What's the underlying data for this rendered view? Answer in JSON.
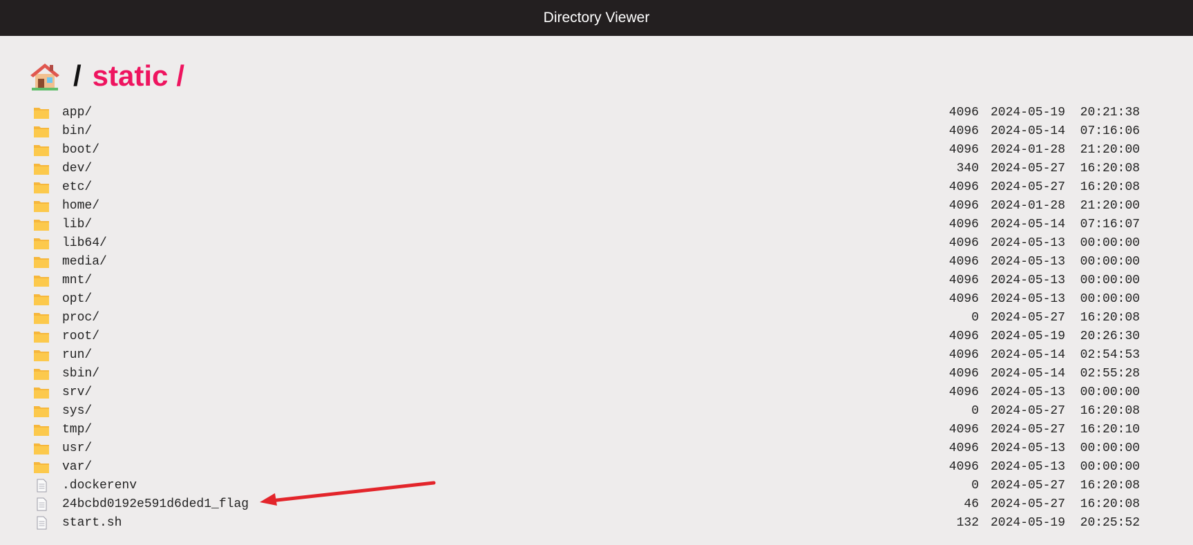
{
  "window": {
    "title": "Directory Viewer"
  },
  "breadcrumb": {
    "home_icon": "house-icon",
    "separator": "/",
    "current_dir": "static",
    "trailing_separator": "/"
  },
  "colors": {
    "topbar": "#231f20",
    "background": "#eeecec",
    "accent": "#ee145f",
    "folder": "#f6b73c",
    "annotation_arrow": "#e3252b"
  },
  "entries": [
    {
      "type": "folder",
      "icon": "folder-icon",
      "name": "app/",
      "size": "4096",
      "date": "2024-05-19",
      "time": "20:21:38"
    },
    {
      "type": "folder",
      "icon": "folder-icon",
      "name": "bin/",
      "size": "4096",
      "date": "2024-05-14",
      "time": "07:16:06"
    },
    {
      "type": "folder",
      "icon": "folder-icon",
      "name": "boot/",
      "size": "4096",
      "date": "2024-01-28",
      "time": "21:20:00"
    },
    {
      "type": "folder",
      "icon": "folder-icon",
      "name": "dev/",
      "size": "340",
      "date": "2024-05-27",
      "time": "16:20:08"
    },
    {
      "type": "folder",
      "icon": "folder-icon",
      "name": "etc/",
      "size": "4096",
      "date": "2024-05-27",
      "time": "16:20:08"
    },
    {
      "type": "folder",
      "icon": "folder-icon",
      "name": "home/",
      "size": "4096",
      "date": "2024-01-28",
      "time": "21:20:00"
    },
    {
      "type": "folder",
      "icon": "folder-icon",
      "name": "lib/",
      "size": "4096",
      "date": "2024-05-14",
      "time": "07:16:07"
    },
    {
      "type": "folder",
      "icon": "folder-icon",
      "name": "lib64/",
      "size": "4096",
      "date": "2024-05-13",
      "time": "00:00:00"
    },
    {
      "type": "folder",
      "icon": "folder-icon",
      "name": "media/",
      "size": "4096",
      "date": "2024-05-13",
      "time": "00:00:00"
    },
    {
      "type": "folder",
      "icon": "folder-icon",
      "name": "mnt/",
      "size": "4096",
      "date": "2024-05-13",
      "time": "00:00:00"
    },
    {
      "type": "folder",
      "icon": "folder-icon",
      "name": "opt/",
      "size": "4096",
      "date": "2024-05-13",
      "time": "00:00:00"
    },
    {
      "type": "folder",
      "icon": "folder-icon",
      "name": "proc/",
      "size": "0",
      "date": "2024-05-27",
      "time": "16:20:08"
    },
    {
      "type": "folder",
      "icon": "folder-icon",
      "name": "root/",
      "size": "4096",
      "date": "2024-05-19",
      "time": "20:26:30"
    },
    {
      "type": "folder",
      "icon": "folder-icon",
      "name": "run/",
      "size": "4096",
      "date": "2024-05-14",
      "time": "02:54:53"
    },
    {
      "type": "folder",
      "icon": "folder-icon",
      "name": "sbin/",
      "size": "4096",
      "date": "2024-05-14",
      "time": "02:55:28"
    },
    {
      "type": "folder",
      "icon": "folder-icon",
      "name": "srv/",
      "size": "4096",
      "date": "2024-05-13",
      "time": "00:00:00"
    },
    {
      "type": "folder",
      "icon": "folder-icon",
      "name": "sys/",
      "size": "0",
      "date": "2024-05-27",
      "time": "16:20:08"
    },
    {
      "type": "folder",
      "icon": "folder-icon",
      "name": "tmp/",
      "size": "4096",
      "date": "2024-05-27",
      "time": "16:20:10"
    },
    {
      "type": "folder",
      "icon": "folder-icon",
      "name": "usr/",
      "size": "4096",
      "date": "2024-05-13",
      "time": "00:00:00"
    },
    {
      "type": "folder",
      "icon": "folder-icon",
      "name": "var/",
      "size": "4096",
      "date": "2024-05-13",
      "time": "00:00:00"
    },
    {
      "type": "file",
      "icon": "file-icon",
      "name": ".dockerenv",
      "size": "0",
      "date": "2024-05-27",
      "time": "16:20:08"
    },
    {
      "type": "file",
      "icon": "file-icon",
      "name": "24bcbd0192e591d6ded1_flag",
      "size": "46",
      "date": "2024-05-27",
      "time": "16:20:08"
    },
    {
      "type": "file",
      "icon": "file-icon",
      "name": "start.sh",
      "size": "132",
      "date": "2024-05-19",
      "time": "20:25:52"
    }
  ],
  "annotation": {
    "icon": "red-arrow-icon",
    "points_to": "24bcbd0192e591d6ded1_flag"
  }
}
